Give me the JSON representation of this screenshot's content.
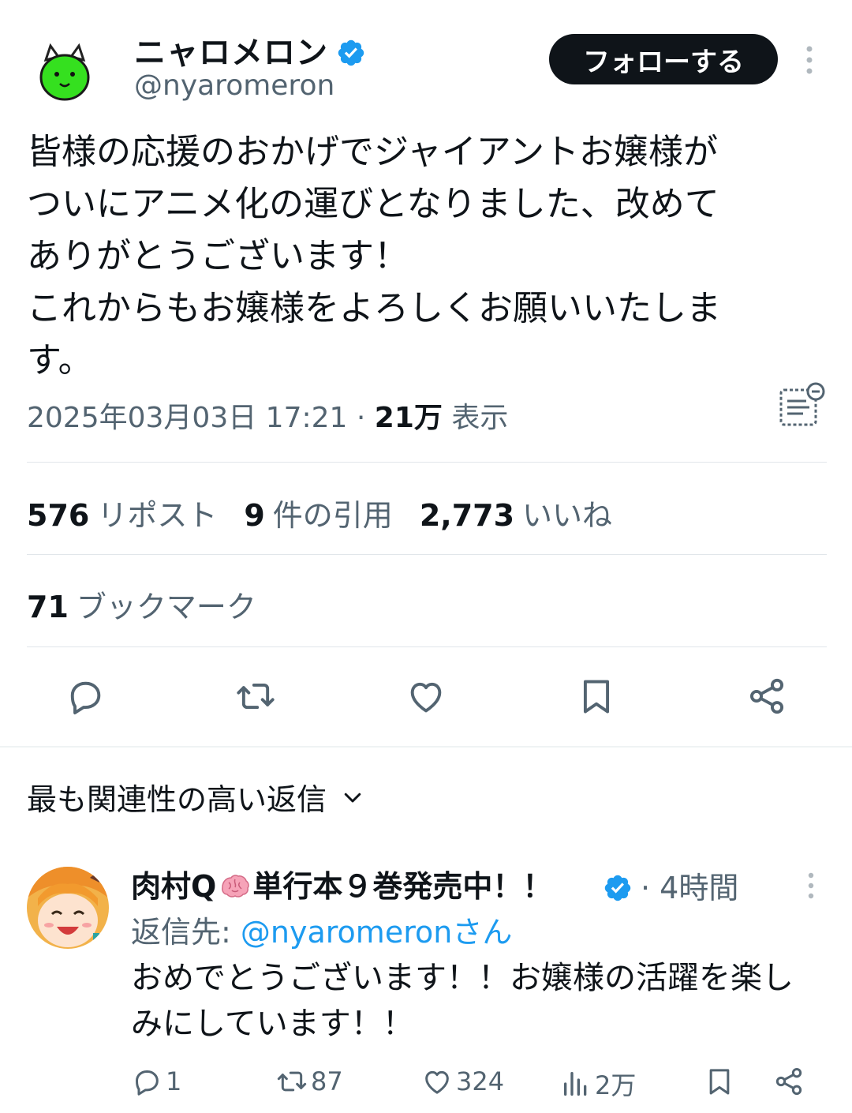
{
  "author": {
    "name": "ニャロメロン",
    "handle": "@nyaromeron",
    "follow_label": "フォローする"
  },
  "tweet": {
    "text": "皆様の応援のおかげでジャイアントお嬢様が\nついにアニメ化の運びとなりました、改めて\nありがとうございます！\nこれからもお嬢様をよろしくお願いいたしま\nす。",
    "timestamp": "2025年03月03日 17:21",
    "separator": "·",
    "views_count": "21万",
    "views_label": "表示"
  },
  "stats": {
    "reposts_count": "576",
    "reposts_label": "リポスト",
    "quotes_count": "9",
    "quotes_label": "件の引用",
    "likes_count": "2,773",
    "likes_label": "いいね",
    "bookmarks_count": "71",
    "bookmarks_label": "ブックマーク"
  },
  "replies_sort": {
    "label": "最も関連性の高い返信"
  },
  "reply": {
    "name_prefix": "肉村Q",
    "name_suffix": "単行本９巻発売中！！",
    "time": "· 4時間",
    "reply_to_label": "返信先:",
    "reply_to_handle": "@nyaromeronさん",
    "text": "おめでとうございます！！お嬢様の活躍を楽し\nみにしています！！",
    "replies": "1",
    "reposts": "87",
    "likes": "324",
    "views": "2万"
  },
  "colors": {
    "accent": "#1d9bf0",
    "text": "#0f1419",
    "muted": "#536471",
    "divider": "#eff3f4"
  },
  "icons": [
    "verified-badge-icon",
    "more-icon",
    "translate-icon",
    "reply-icon",
    "repost-icon",
    "like-icon",
    "bookmark-icon",
    "share-icon",
    "chevron-down-icon",
    "views-icon",
    "brain-emoji-icon"
  ]
}
